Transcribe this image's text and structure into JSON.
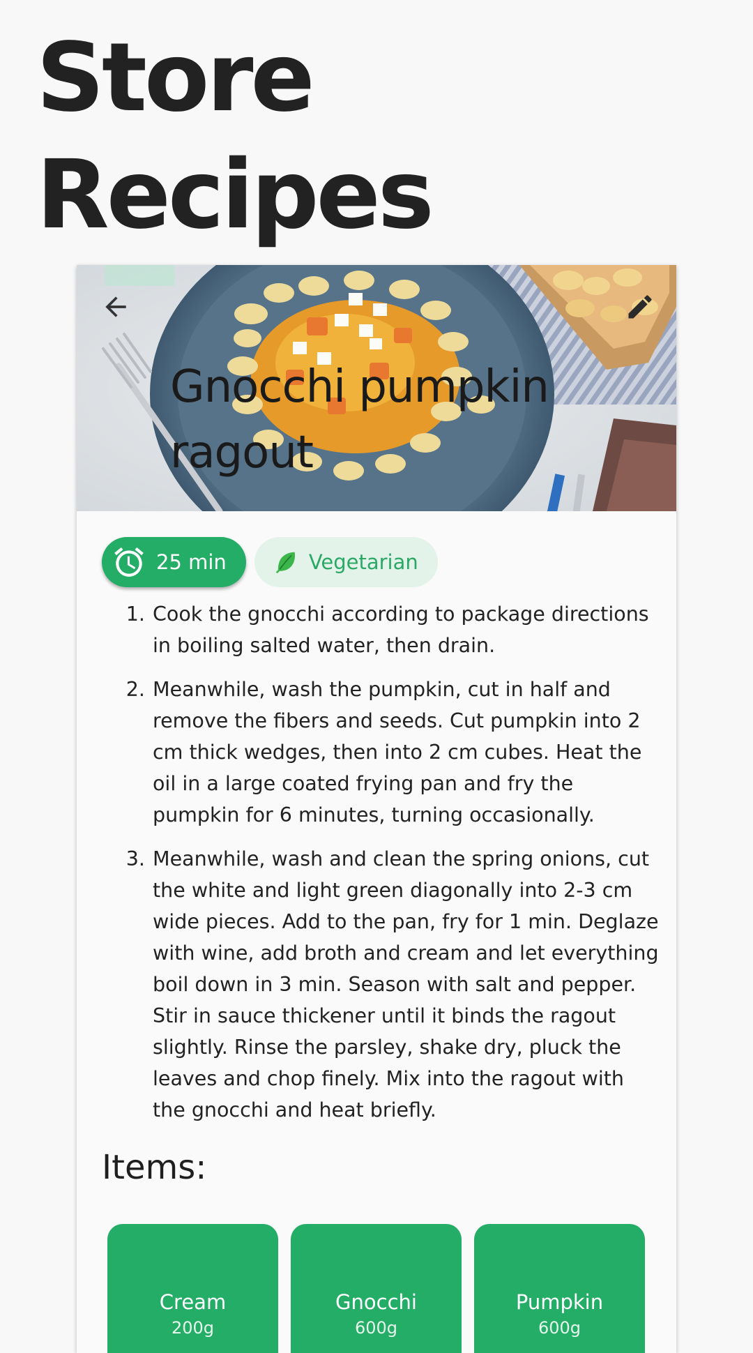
{
  "page": {
    "title_line1": "Store",
    "title_line2": "Recipes"
  },
  "recipe": {
    "title_line1": "Gnocchi pumpkin",
    "title_line2": "ragout",
    "hero_icons": {
      "back": "arrow-left-icon",
      "edit": "pencil-icon"
    },
    "chips": {
      "time": {
        "label": "25 min",
        "icon": "alarm-clock-icon"
      },
      "diet": {
        "label": "Vegetarian",
        "icon": "leaf-icon"
      }
    },
    "steps": [
      {
        "number": "1.",
        "text": "Cook the gnocchi according to package directions in boiling salted water, then drain."
      },
      {
        "number": "2.",
        "text": "Meanwhile, wash the pumpkin, cut in half and remove the fibers and seeds. Cut pumpkin into 2 cm thick wedges, then into 2 cm cubes. Heat the oil in a large coated frying pan and fry the pumpkin for 6 minutes, turning occasionally."
      },
      {
        "number": "3.",
        "text": "Meanwhile, wash and clean the spring onions, cut the white and light green diagonally into 2-3 cm wide pieces. Add to the pan, fry for 1 min. Deglaze with wine, add broth and cream and let everything boil down in 3 min. Season with salt and pepper. Stir in sauce thickener until it binds the ragout slightly. Rinse the parsley, shake dry, pluck the leaves and chop finely. Mix into the ragout with the gnocchi and heat briefly."
      }
    ],
    "items_heading": "Items:",
    "items": [
      {
        "name": "Cream",
        "amount": "200g"
      },
      {
        "name": "Gnocchi",
        "amount": "600g"
      },
      {
        "name": "Pumpkin",
        "amount": "600g"
      }
    ]
  },
  "colors": {
    "accent": "#23ad66",
    "chip_light": "#e3f3ea",
    "background": "#f8f8f8"
  }
}
